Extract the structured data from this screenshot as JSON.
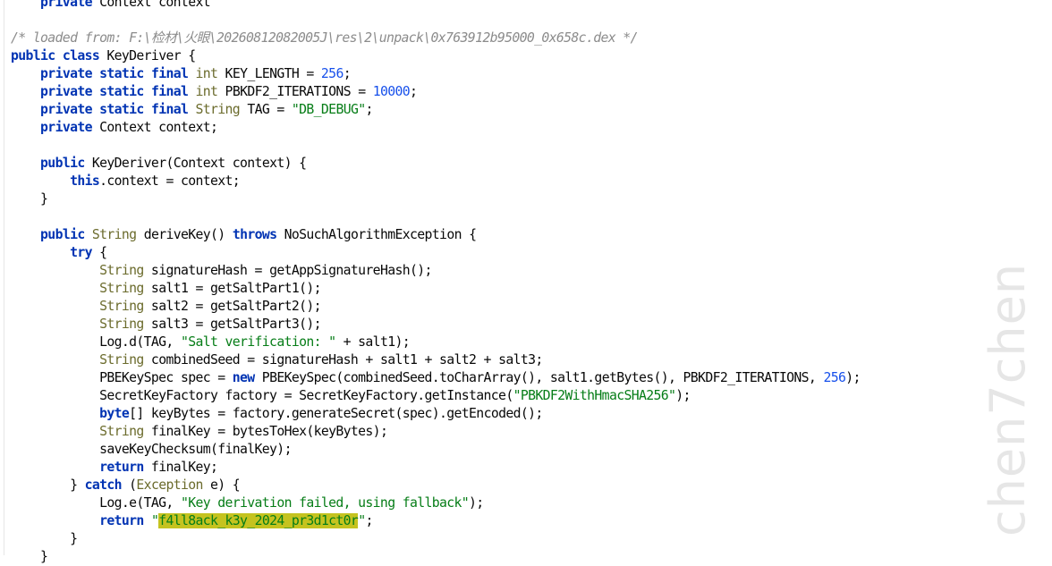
{
  "colors": {
    "background": "#ffffff",
    "keyword": "#0033b3",
    "type": "#6b6b2c",
    "number": "#1750eb",
    "string": "#067d17",
    "comment": "#8c8c8c",
    "highlight": "#c5c31f"
  },
  "watermark": "chen7chen",
  "code": {
    "lines": [
      [
        {
          "t": "    private",
          "c": "kw"
        },
        {
          "t": " Context context",
          "c": ""
        },
        {
          "t": " ",
          "c": ""
        }
      ],
      [
        {
          "t": "",
          "c": ""
        }
      ],
      [
        {
          "t": "/* loaded from: F:\\检材\\火眼\\20260812082005J\\res\\2\\unpack\\0x763912b95000_0x658c.dex */",
          "c": "cmt"
        }
      ],
      [
        {
          "t": "public",
          "c": "kw"
        },
        {
          "t": " ",
          "c": ""
        },
        {
          "t": "class",
          "c": "kw"
        },
        {
          "t": " KeyDeriver {",
          "c": ""
        }
      ],
      [
        {
          "t": "    ",
          "c": ""
        },
        {
          "t": "private",
          "c": "kw"
        },
        {
          "t": " ",
          "c": ""
        },
        {
          "t": "static",
          "c": "kw"
        },
        {
          "t": " ",
          "c": ""
        },
        {
          "t": "final",
          "c": "kw"
        },
        {
          "t": " ",
          "c": ""
        },
        {
          "t": "int",
          "c": "ty"
        },
        {
          "t": " KEY_LENGTH = ",
          "c": ""
        },
        {
          "t": "256",
          "c": "num"
        },
        {
          "t": ";",
          "c": ""
        }
      ],
      [
        {
          "t": "    ",
          "c": ""
        },
        {
          "t": "private",
          "c": "kw"
        },
        {
          "t": " ",
          "c": ""
        },
        {
          "t": "static",
          "c": "kw"
        },
        {
          "t": " ",
          "c": ""
        },
        {
          "t": "final",
          "c": "kw"
        },
        {
          "t": " ",
          "c": ""
        },
        {
          "t": "int",
          "c": "ty"
        },
        {
          "t": " PBKDF2_ITERATIONS = ",
          "c": ""
        },
        {
          "t": "10000",
          "c": "num"
        },
        {
          "t": ";",
          "c": ""
        }
      ],
      [
        {
          "t": "    ",
          "c": ""
        },
        {
          "t": "private",
          "c": "kw"
        },
        {
          "t": " ",
          "c": ""
        },
        {
          "t": "static",
          "c": "kw"
        },
        {
          "t": " ",
          "c": ""
        },
        {
          "t": "final",
          "c": "kw"
        },
        {
          "t": " ",
          "c": ""
        },
        {
          "t": "String",
          "c": "ty"
        },
        {
          "t": " TAG = ",
          "c": ""
        },
        {
          "t": "\"DB_DEBUG\"",
          "c": "str"
        },
        {
          "t": ";",
          "c": ""
        }
      ],
      [
        {
          "t": "    ",
          "c": ""
        },
        {
          "t": "private",
          "c": "kw"
        },
        {
          "t": " Context context;",
          "c": ""
        }
      ],
      [
        {
          "t": "",
          "c": ""
        }
      ],
      [
        {
          "t": "    ",
          "c": ""
        },
        {
          "t": "public",
          "c": "kw"
        },
        {
          "t": " KeyDeriver(Context context) {",
          "c": ""
        }
      ],
      [
        {
          "t": "        ",
          "c": ""
        },
        {
          "t": "this",
          "c": "kw"
        },
        {
          "t": ".context = context;",
          "c": ""
        }
      ],
      [
        {
          "t": "    }",
          "c": ""
        }
      ],
      [
        {
          "t": "",
          "c": ""
        }
      ],
      [
        {
          "t": "    ",
          "c": ""
        },
        {
          "t": "public",
          "c": "kw"
        },
        {
          "t": " ",
          "c": ""
        },
        {
          "t": "String",
          "c": "ty"
        },
        {
          "t": " deriveKey() ",
          "c": ""
        },
        {
          "t": "throws",
          "c": "kw"
        },
        {
          "t": " NoSuchAlgorithmException {",
          "c": ""
        }
      ],
      [
        {
          "t": "        ",
          "c": ""
        },
        {
          "t": "try",
          "c": "kw"
        },
        {
          "t": " {",
          "c": ""
        }
      ],
      [
        {
          "t": "            ",
          "c": ""
        },
        {
          "t": "String",
          "c": "ty"
        },
        {
          "t": " signatureHash = getAppSignatureHash();",
          "c": ""
        }
      ],
      [
        {
          "t": "            ",
          "c": ""
        },
        {
          "t": "String",
          "c": "ty"
        },
        {
          "t": " salt1 = getSaltPart1();",
          "c": ""
        }
      ],
      [
        {
          "t": "            ",
          "c": ""
        },
        {
          "t": "String",
          "c": "ty"
        },
        {
          "t": " salt2 = getSaltPart2();",
          "c": ""
        }
      ],
      [
        {
          "t": "            ",
          "c": ""
        },
        {
          "t": "String",
          "c": "ty"
        },
        {
          "t": " salt3 = getSaltPart3();",
          "c": ""
        }
      ],
      [
        {
          "t": "            Log.d(TAG, ",
          "c": ""
        },
        {
          "t": "\"Salt verification: \"",
          "c": "str"
        },
        {
          "t": " + salt1);",
          "c": ""
        }
      ],
      [
        {
          "t": "            ",
          "c": ""
        },
        {
          "t": "String",
          "c": "ty"
        },
        {
          "t": " combinedSeed = signatureHash + salt1 + salt2 + salt3;",
          "c": ""
        }
      ],
      [
        {
          "t": "            PBEKeySpec spec = ",
          "c": ""
        },
        {
          "t": "new",
          "c": "kw"
        },
        {
          "t": " PBEKeySpec(combinedSeed.toCharArray(), salt1.getBytes(), PBKDF2_ITERATIONS, ",
          "c": ""
        },
        {
          "t": "256",
          "c": "num"
        },
        {
          "t": ");",
          "c": ""
        }
      ],
      [
        {
          "t": "            SecretKeyFactory factory = SecretKeyFactory.getInstance(",
          "c": ""
        },
        {
          "t": "\"PBKDF2WithHmacSHA256\"",
          "c": "str"
        },
        {
          "t": ");",
          "c": ""
        }
      ],
      [
        {
          "t": "            ",
          "c": ""
        },
        {
          "t": "byte",
          "c": "kw"
        },
        {
          "t": "[] keyBytes = factory.generateSecret(spec).getEncoded();",
          "c": ""
        }
      ],
      [
        {
          "t": "            ",
          "c": ""
        },
        {
          "t": "String",
          "c": "ty"
        },
        {
          "t": " finalKey = bytesToHex(keyBytes);",
          "c": ""
        }
      ],
      [
        {
          "t": "            saveKeyChecksum(finalKey);",
          "c": ""
        }
      ],
      [
        {
          "t": "            ",
          "c": ""
        },
        {
          "t": "return",
          "c": "kw"
        },
        {
          "t": " finalKey;",
          "c": ""
        }
      ],
      [
        {
          "t": "        } ",
          "c": ""
        },
        {
          "t": "catch",
          "c": "kw"
        },
        {
          "t": " (",
          "c": ""
        },
        {
          "t": "Exception",
          "c": "ty"
        },
        {
          "t": " e) {",
          "c": ""
        }
      ],
      [
        {
          "t": "            Log.e(TAG, ",
          "c": ""
        },
        {
          "t": "\"Key derivation failed, using fallback\"",
          "c": "str"
        },
        {
          "t": ");",
          "c": ""
        }
      ],
      [
        {
          "t": "            ",
          "c": ""
        },
        {
          "t": "return",
          "c": "kw"
        },
        {
          "t": " ",
          "c": ""
        },
        {
          "t": "\"",
          "c": "str"
        },
        {
          "t": "f4ll8ack_k3y_2024_pr3d1ct0r",
          "c": "str hl"
        },
        {
          "t": "\"",
          "c": "str"
        },
        {
          "t": ";",
          "c": ""
        }
      ],
      [
        {
          "t": "        }",
          "c": ""
        }
      ],
      [
        {
          "t": "    }",
          "c": ""
        }
      ]
    ]
  }
}
